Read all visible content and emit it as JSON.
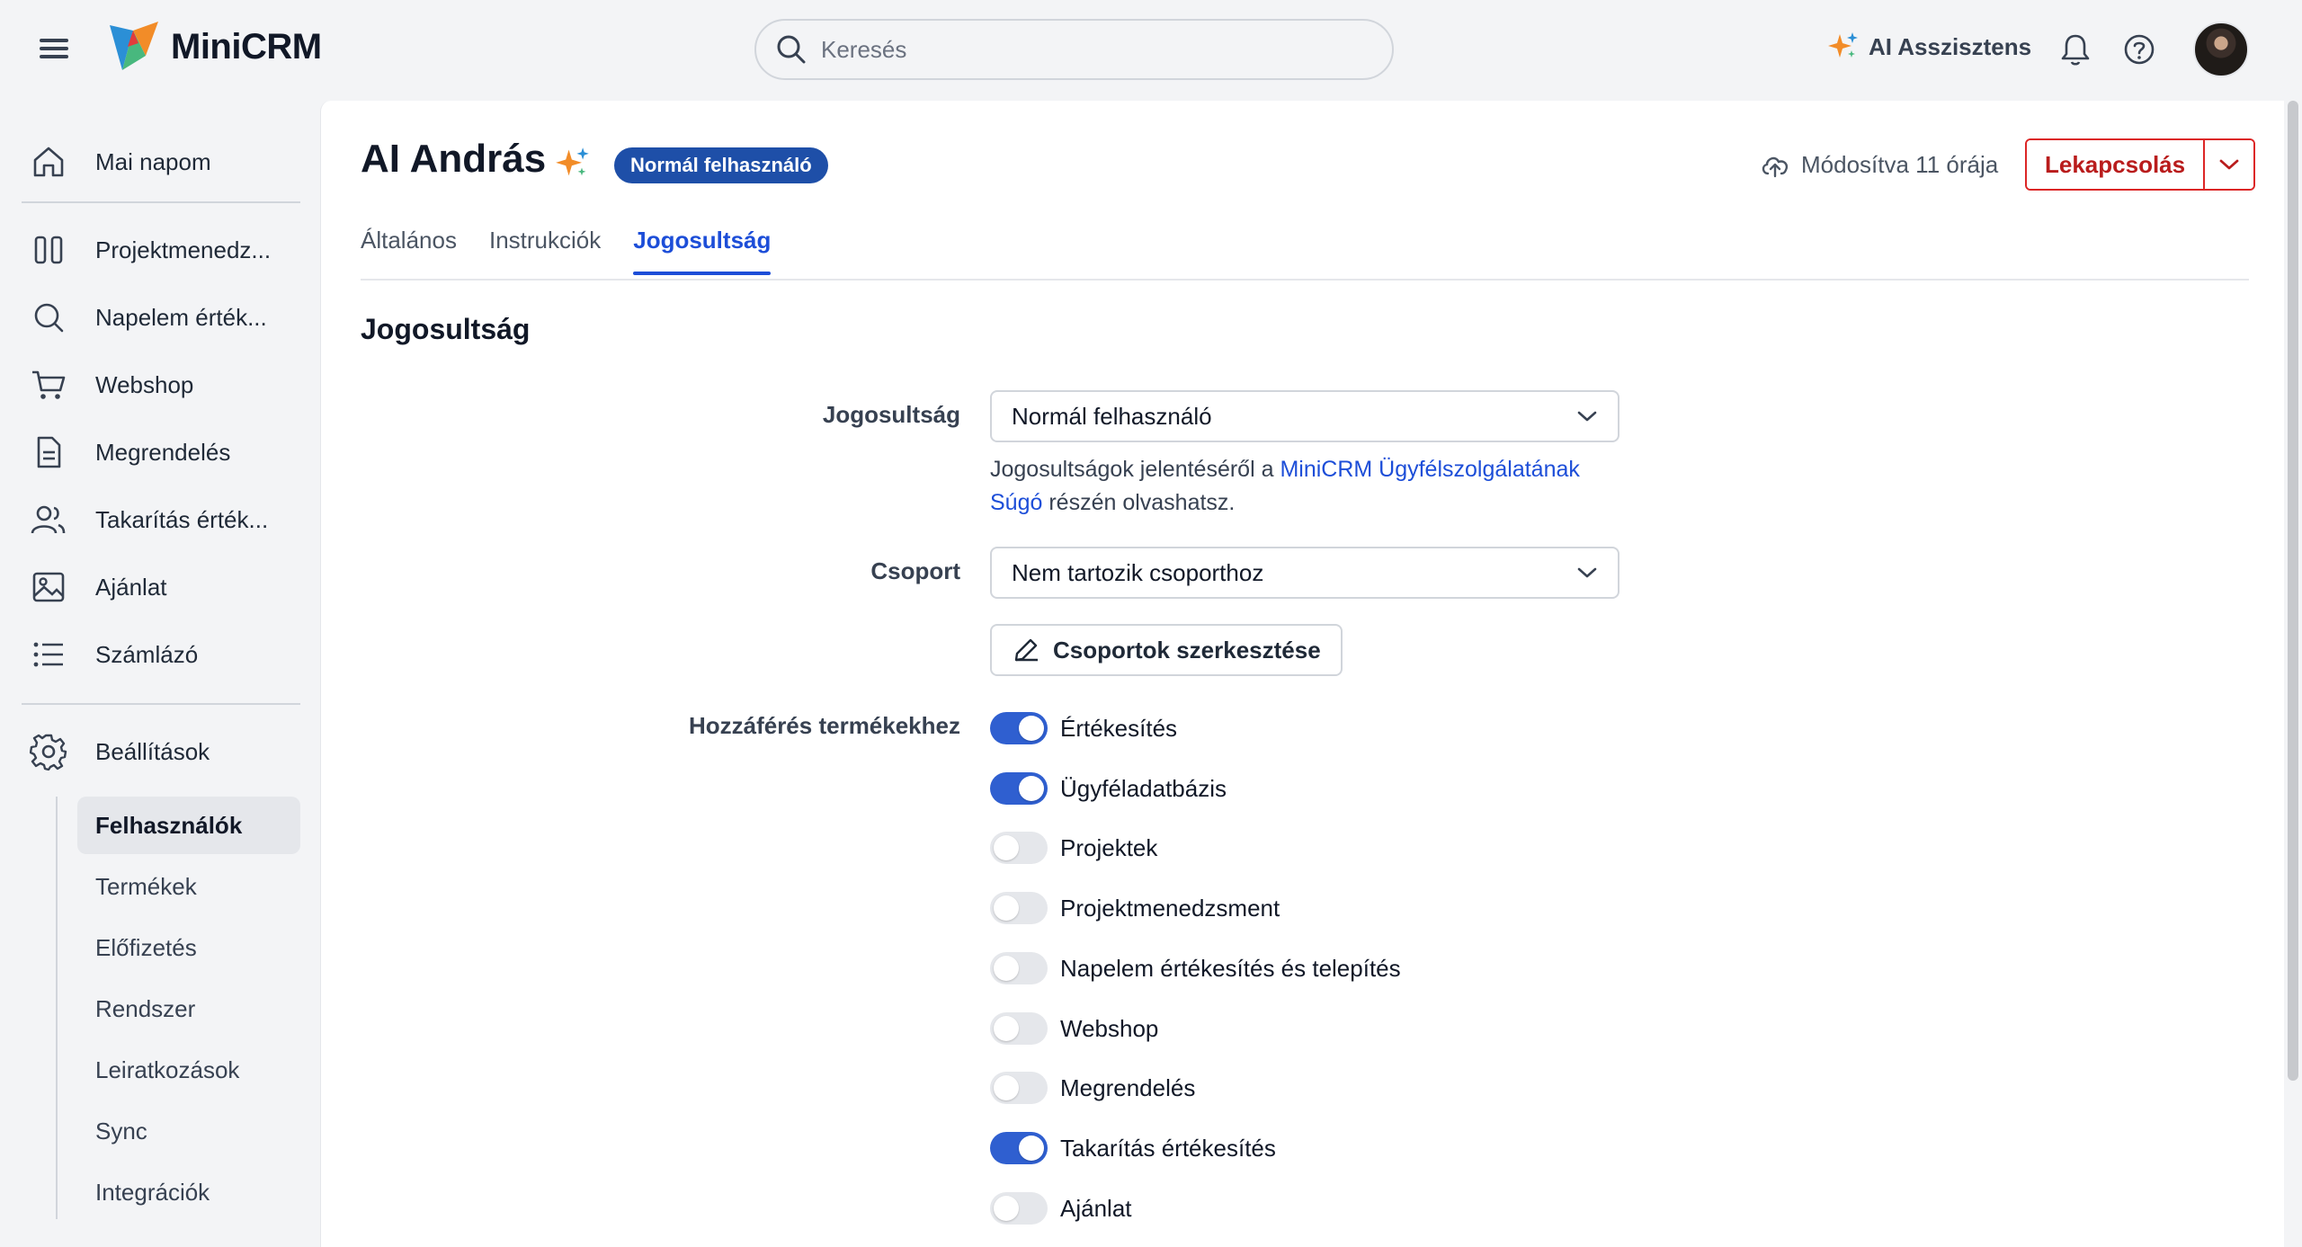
{
  "app": {
    "name": "MiniCRM"
  },
  "search": {
    "placeholder": "Keresés"
  },
  "header": {
    "ai_label": "AI Asszisztens"
  },
  "sidebar": {
    "items": [
      {
        "label": "Mai napom",
        "icon": "home-icon"
      },
      {
        "label": "Projektmenedz...",
        "icon": "columns-icon"
      },
      {
        "label": "Napelem érték...",
        "icon": "search-icon"
      },
      {
        "label": "Webshop",
        "icon": "cart-icon"
      },
      {
        "label": "Megrendelés",
        "icon": "document-icon"
      },
      {
        "label": "Takarítás érték...",
        "icon": "users-icon"
      },
      {
        "label": "Ajánlat",
        "icon": "image-icon"
      },
      {
        "label": "Számlázó",
        "icon": "list-icon"
      }
    ],
    "settings_label": "Beállítások",
    "settings_items": [
      {
        "label": "Felhasználók",
        "active": true
      },
      {
        "label": "Termékek",
        "active": false
      },
      {
        "label": "Előfizetés",
        "active": false
      },
      {
        "label": "Rendszer",
        "active": false
      },
      {
        "label": "Leiratkozások",
        "active": false
      },
      {
        "label": "Sync",
        "active": false
      },
      {
        "label": "Integrációk",
        "active": false
      }
    ]
  },
  "page": {
    "title": "AI András",
    "badge": "Normál felhasználó",
    "modified": "Módosítva 11 órája",
    "disable_button": "Lekapcsolás",
    "tabs": [
      "Általános",
      "Instrukciók",
      "Jogosultság"
    ],
    "active_tab": "Jogosultság",
    "section_title": "Jogosultság"
  },
  "form": {
    "permission_label": "Jogosultság",
    "permission_value": "Normál felhasználó",
    "help_prefix": "Jogosultságok jelentéséről a ",
    "help_link": "MiniCRM Ügyfélszolgálatának Súgó",
    "help_suffix": " részén olvashatsz.",
    "group_label": "Csoport",
    "group_value": "Nem tartozik csoporthoz",
    "edit_groups_button": "Csoportok szerkesztése",
    "access_label": "Hozzáférés termékekhez",
    "products": [
      {
        "label": "Értékesítés",
        "enabled": true
      },
      {
        "label": "Ügyféladatbázis",
        "enabled": true
      },
      {
        "label": "Projektek",
        "enabled": false
      },
      {
        "label": "Projektmenedzsment",
        "enabled": false
      },
      {
        "label": "Napelem értékesítés és telepítés",
        "enabled": false
      },
      {
        "label": "Webshop",
        "enabled": false
      },
      {
        "label": "Megrendelés",
        "enabled": false
      },
      {
        "label": "Takarítás értékesítés",
        "enabled": true
      },
      {
        "label": "Ajánlat",
        "enabled": false
      }
    ]
  },
  "colors": {
    "accent": "#1d4ed8",
    "toggle_on": "#2f5fd0",
    "danger": "#dc2626",
    "badge": "#1e4fa8"
  }
}
